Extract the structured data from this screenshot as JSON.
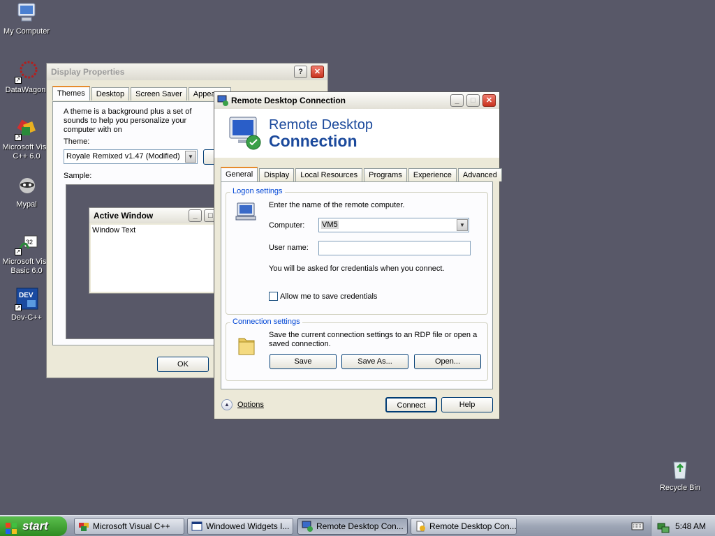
{
  "desktop": {
    "icons": [
      {
        "label": "My Computer"
      },
      {
        "label": "DataWagon."
      },
      {
        "label": "Microsoft Visu C++ 6.0"
      },
      {
        "label": "Mypal"
      },
      {
        "label": "Microsoft Visu Basic 6.0"
      },
      {
        "label": "Dev-C++"
      },
      {
        "label": "Recycle Bin"
      }
    ],
    "dev_icon_text": "DEV"
  },
  "display_properties": {
    "title": "Display Properties",
    "help_glyph": "?",
    "close_glyph": "✕",
    "tabs": [
      "Themes",
      "Desktop",
      "Screen Saver",
      "Appearan"
    ],
    "description": "A theme is a background plus a set of sounds to help you personalize your computer with on",
    "theme_label": "Theme:",
    "theme_value": "Royale Remixed v1.47 (Modified)",
    "save_as_partial": "S",
    "sample_label": "Sample:",
    "sample_window_title": "Active Window",
    "sample_window_text": "Window Text",
    "ok_label": "OK"
  },
  "rdc": {
    "title": "Remote Desktop Connection",
    "minimize_glyph": "_",
    "maximize_glyph": "□",
    "close_glyph": "✕",
    "banner_line1": "Remote Desktop",
    "banner_line2": "Connection",
    "tabs": [
      "General",
      "Display",
      "Local Resources",
      "Programs",
      "Experience",
      "Advanced"
    ],
    "logon_group": "Logon settings",
    "logon_instructions": "Enter the name of the remote computer.",
    "computer_label": "Computer:",
    "computer_value": "VM5",
    "username_label": "User name:",
    "username_value": "",
    "credentials_note": "You will be asked for credentials when you connect.",
    "save_credentials_label": "Allow me to save credentials",
    "save_credentials_checked": false,
    "connection_group": "Connection settings",
    "connection_text": "Save the current connection settings to an RDP file or open a saved connection.",
    "save_label": "Save",
    "save_as_label": "Save As...",
    "open_label": "Open...",
    "options_label": "Options",
    "connect_label": "Connect",
    "help_label": "Help"
  },
  "taskbar": {
    "start_label": "start",
    "tasks": [
      {
        "label": "Microsoft Visual C++",
        "active": false
      },
      {
        "label": "Windowed Widgets I...",
        "active": false
      },
      {
        "label": "Remote Desktop Con...",
        "active": true
      },
      {
        "label": "Remote Desktop Con...",
        "active": false
      }
    ],
    "clock": "5:48 AM"
  },
  "colors": {
    "desktop_bg": "#585868",
    "rdc_banner_text": "#1c4a9c",
    "legend_blue": "#0046d5",
    "tab_accent": "#e68b2c"
  }
}
